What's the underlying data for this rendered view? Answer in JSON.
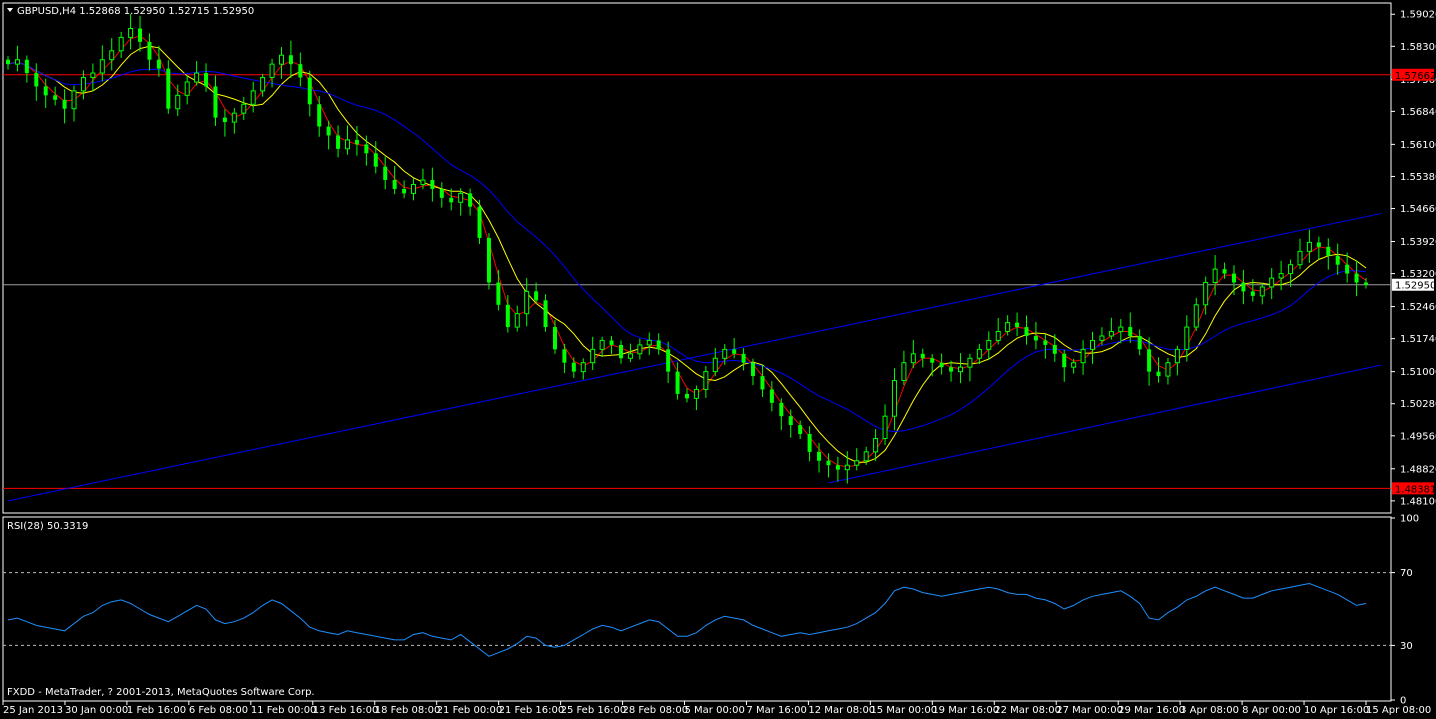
{
  "window": {
    "symbol_header": "GBPUSD,H4  1.52868 1.52950 1.52715 1.52950",
    "footer": "FXDD - MetaTrader, ? 2001-2013, MetaQuotes Software Corp."
  },
  "colors": {
    "background": "#000000",
    "bull_candle": "#00ff00",
    "bear_candle": "#00ff00",
    "fast_ma": "#ff0000",
    "mid_ma": "#ffff00",
    "slow_ma": "#0000ff",
    "trendlines": "#0000ff",
    "support_resistance": "#ff0000",
    "rsi_line": "#1e90ff",
    "grid_text": "#ffffff",
    "price_badge_bg": "#ffffff"
  },
  "chart_data": [
    {
      "type": "candlestick",
      "series": [
        {
          "name": "",
          "kind": "ohlc"
        },
        {
          "name": "",
          "kind": "moving-average-fast"
        },
        {
          "name": "",
          "kind": "moving-average-medium"
        },
        {
          "name": "",
          "kind": "moving-average-slow"
        }
      ],
      "y_ticks": [
        "1.59020",
        "1.58300",
        "1.57560",
        "1.56840",
        "1.56100",
        "1.55380",
        "1.54660",
        "1.53920",
        "1.53200",
        "1.52460",
        "1.51740",
        "1.51000",
        "1.50280",
        "1.49560",
        "1.48820",
        "1.48100"
      ],
      "ylim": [
        1.4785,
        1.5925
      ],
      "x_ticks": [
        "25 Jan 2013",
        "30 Jan 00:00",
        "1 Feb 16:00",
        "6 Feb 08:00",
        "11 Feb 00:00",
        "13 Feb 16:00",
        "18 Feb 08:00",
        "21 Feb 00:00",
        "21 Feb 16:00",
        "25 Feb 16:00",
        "28 Feb 08:00",
        "5 Mar 00:00",
        "7 Mar 16:00",
        "12 Mar 08:00",
        "15 Mar 00:00",
        "19 Mar 16:00",
        "22 Mar 08:00",
        "27 Mar 00:00",
        "29 Mar 16:00",
        "3 Apr 08:00",
        "8 Apr 00:00",
        "10 Apr 16:00",
        "15 Apr 08:00"
      ],
      "current_price": "1.52950",
      "resistance_level": "1.57662",
      "support_level": "1.48381",
      "closes": [
        1.579,
        1.58,
        1.577,
        1.574,
        1.572,
        1.571,
        1.569,
        1.573,
        1.576,
        1.577,
        1.58,
        1.582,
        1.585,
        1.587,
        1.584,
        1.58,
        1.578,
        1.569,
        1.572,
        1.575,
        1.577,
        1.574,
        1.567,
        1.566,
        1.568,
        1.57,
        1.573,
        1.576,
        1.579,
        1.581,
        1.579,
        1.576,
        1.57,
        1.565,
        1.563,
        1.56,
        1.562,
        1.561,
        1.559,
        1.556,
        1.553,
        1.551,
        1.55,
        1.552,
        1.553,
        1.551,
        1.549,
        1.548,
        1.55,
        1.547,
        1.54,
        1.53,
        1.525,
        1.52,
        1.523,
        1.528,
        1.526,
        1.52,
        1.515,
        1.512,
        1.51,
        1.512,
        1.515,
        1.517,
        1.516,
        1.513,
        1.514,
        1.516,
        1.517,
        1.515,
        1.51,
        1.505,
        1.504,
        1.506,
        1.51,
        1.513,
        1.515,
        1.514,
        1.512,
        1.509,
        1.506,
        1.503,
        1.5,
        1.498,
        1.496,
        1.492,
        1.49,
        1.489,
        1.488,
        1.489,
        1.49,
        1.492,
        1.495,
        1.5,
        1.508,
        1.512,
        1.514,
        1.513,
        1.512,
        1.511,
        1.51,
        1.511,
        1.513,
        1.515,
        1.517,
        1.519,
        1.521,
        1.52,
        1.518,
        1.517,
        1.516,
        1.514,
        1.511,
        1.512,
        1.515,
        1.517,
        1.518,
        1.519,
        1.52,
        1.518,
        1.515,
        1.51,
        1.509,
        1.512,
        1.515,
        1.52,
        1.525,
        1.53,
        1.533,
        1.532,
        1.53,
        1.528,
        1.527,
        1.529,
        1.531,
        1.532,
        1.534,
        1.537,
        1.539,
        1.538,
        1.536,
        1.534,
        1.532,
        1.53,
        1.5295
      ],
      "rsi": {
        "label": "RSI(28) 50.3319",
        "period": 28,
        "value": 50.3319,
        "levels": [
          30,
          70
        ],
        "ylim": [
          0,
          100
        ],
        "y_ticks": [
          "100",
          "70",
          "30",
          "0"
        ],
        "values": [
          44,
          45,
          43,
          41,
          40,
          39,
          38,
          42,
          46,
          48,
          52,
          54,
          55,
          53,
          50,
          47,
          45,
          43,
          46,
          49,
          52,
          50,
          44,
          42,
          43,
          45,
          48,
          52,
          55,
          53,
          49,
          45,
          40,
          38,
          37,
          36,
          38,
          37,
          36,
          35,
          34,
          33,
          33,
          36,
          37,
          35,
          34,
          33,
          36,
          32,
          28,
          24,
          26,
          28,
          31,
          35,
          34,
          30,
          29,
          30,
          33,
          36,
          39,
          41,
          40,
          38,
          40,
          42,
          44,
          43,
          39,
          35,
          35,
          37,
          41,
          44,
          46,
          45,
          44,
          41,
          39,
          37,
          35,
          36,
          37,
          36,
          37,
          38,
          39,
          40,
          42,
          45,
          48,
          53,
          60,
          62,
          61,
          59,
          58,
          57,
          58,
          59,
          60,
          61,
          62,
          61,
          59,
          58,
          58,
          56,
          55,
          53,
          50,
          52,
          55,
          57,
          58,
          59,
          60,
          57,
          53,
          45,
          44,
          48,
          51,
          55,
          57,
          60,
          62,
          60,
          58,
          56,
          56,
          58,
          60,
          61,
          62,
          63,
          64,
          62,
          60,
          58,
          55,
          52,
          53
        ]
      },
      "trendlines": [
        {
          "name": "channel-upper",
          "from": {
            "x_index": 0,
            "price": 1.481
          },
          "to": {
            "x_index": 143,
            "price": 1.5455
          }
        },
        {
          "name": "channel-lower",
          "from": {
            "x_index": 87,
            "price": 1.485
          },
          "to": {
            "x_index": 143,
            "price": 1.5115
          }
        }
      ]
    }
  ]
}
